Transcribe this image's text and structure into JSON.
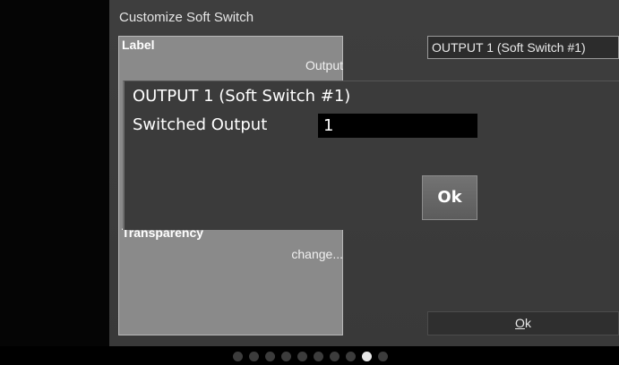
{
  "window": {
    "title": "Customize Soft Switch"
  },
  "properties_panel": {
    "label_heading": "Label",
    "label_value": "Output",
    "transparency_heading": "Transparency",
    "transparency_value": "change..."
  },
  "output_select": {
    "selected": "OUTPUT 1 (Soft Switch #1)"
  },
  "footer": {
    "ok_label": "Ok",
    "ok_mnemonic": "O",
    "ok_rest": "k"
  },
  "modal": {
    "title": "OUTPUT 1 (Soft Switch #1)",
    "field_label": "Switched Output",
    "field_value": "1",
    "ok_label": "Ok"
  },
  "pager": {
    "page_count": 10,
    "active_index": 8
  },
  "colors": {
    "background": "#000000",
    "screen": "#3b3b3b",
    "panel": "#8a8a8a",
    "input_bg": "#000000",
    "dot_active": "#e8e8e8",
    "dot_inactive": "#3c3c3c"
  }
}
